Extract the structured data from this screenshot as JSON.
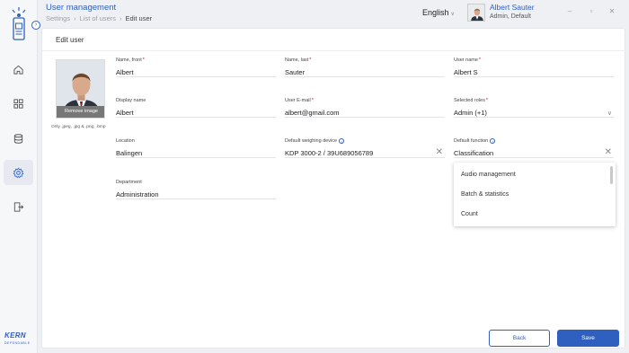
{
  "app": {
    "title": "User management",
    "language": "English",
    "brand": "KERN",
    "brand_sub": "DEPENDABLE"
  },
  "breadcrumb": [
    "Settings",
    "List of users",
    "Edit user"
  ],
  "user": {
    "name": "Albert Sauter",
    "role": "Admin, Default"
  },
  "card": {
    "title": "Edit user",
    "remove_image": "Remove image",
    "image_note": "Only .jpeg, .jpg & .png, .bmp"
  },
  "fields": {
    "first_name": {
      "label": "Name, front",
      "value": "Albert"
    },
    "last_name": {
      "label": "Name, last",
      "value": "Sauter"
    },
    "user_name": {
      "label": "User name",
      "value": "Albert S"
    },
    "display_name": {
      "label": "Display name",
      "value": "Albert"
    },
    "email": {
      "label": "User E-mail",
      "value": "albert@gmail.com"
    },
    "roles": {
      "label": "Selected roles",
      "value": "Admin (+1)"
    },
    "location": {
      "label": "Location",
      "value": "Balingen"
    },
    "weighing_device": {
      "label": "Default weighing device",
      "value": "KDP 3000-2 / 39U689056789"
    },
    "default_function": {
      "label": "Default function",
      "value": "Classification"
    },
    "department": {
      "label": "Department",
      "value": "Administration"
    }
  },
  "function_options": [
    "Audio management",
    "Batch & statistics",
    "Count"
  ],
  "buttons": {
    "back": "Back",
    "save": "Save"
  },
  "colors": {
    "accent": "#2f5fbf",
    "required": "#d0021b"
  },
  "icons": {
    "sidebar": [
      "home-icon",
      "dashboard-icon",
      "database-icon",
      "settings-icon",
      "logout-icon"
    ]
  }
}
